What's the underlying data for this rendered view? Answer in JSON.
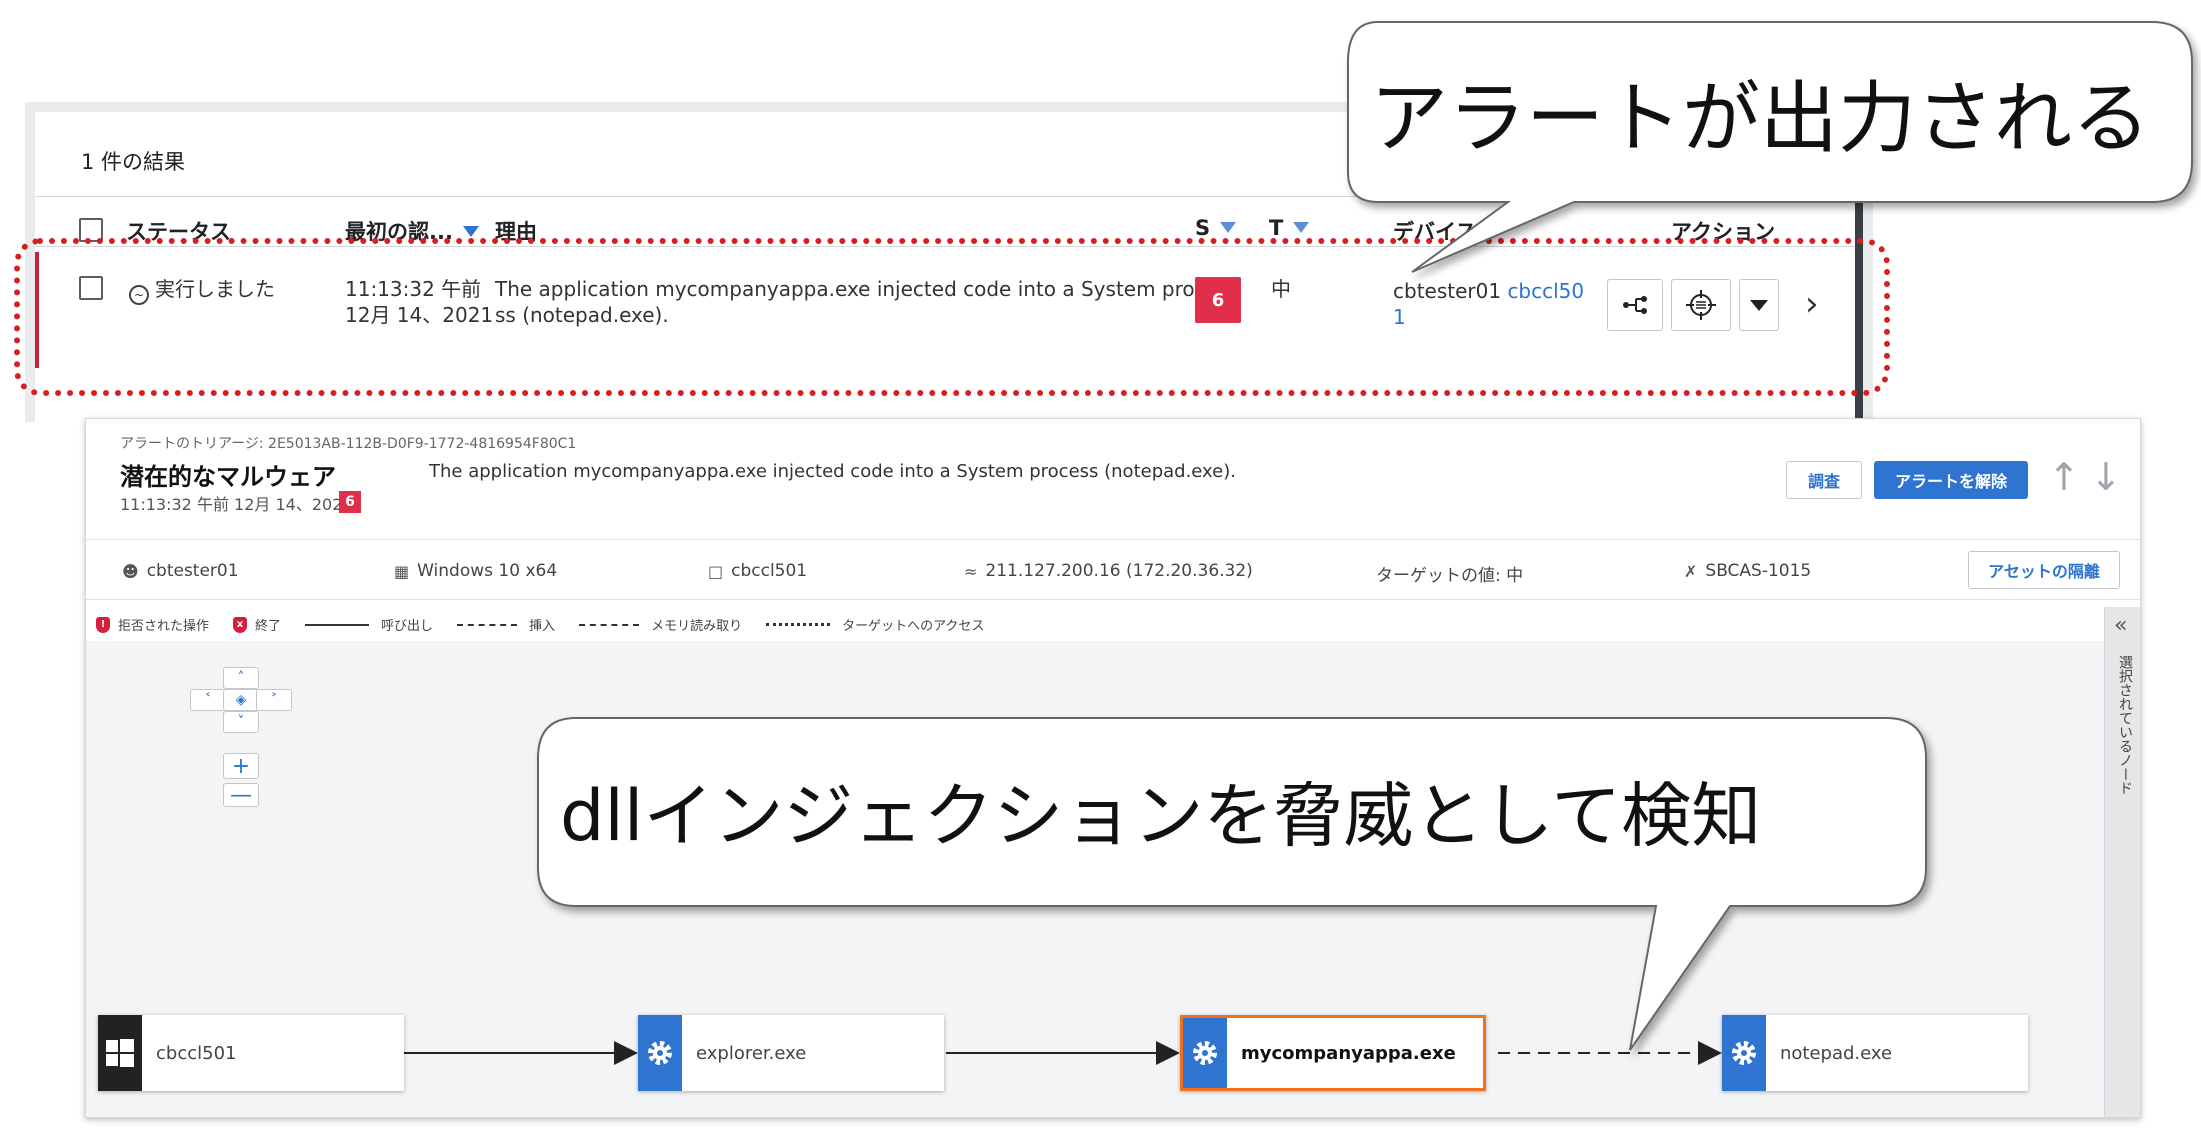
{
  "list": {
    "result_count": "1 件の結果",
    "columns": {
      "status": "ステータス",
      "first_seen": "最初の認...",
      "reason": "理由",
      "s": "S",
      "t": "T",
      "device": "デバイス",
      "actions": "アクション"
    },
    "row": {
      "status": "実行しました",
      "time": "11:13:32 午前",
      "date": "12月 14、2021",
      "reason_line1": "The application mycompanyappa.exe injected code into a System proce",
      "reason_line2": "ss (notepad.exe).",
      "severity": "6",
      "target": "中",
      "device_user": "cbtester01",
      "device_link_line1": "cbccl50",
      "device_link_line2": "1"
    }
  },
  "detail": {
    "triage_id": "アラートのトリアージ: 2E5013AB-112B-D0F9-1772-4816954F80C1",
    "title": "潜在的なマルウェア",
    "time": "11:13:32 午前 12月 14、2021",
    "severity": "6",
    "reason": "The application mycompanyappa.exe injected code into a System process (notepad.exe).",
    "investigate_label": "調査",
    "dismiss_label": "アラートを解除",
    "meta": {
      "user": "cbtester01",
      "os": "Windows 10 x64",
      "device": "cbccl501",
      "ip": "211.127.200.16 (172.20.36.32)",
      "target_value": "ターゲットの値: 中",
      "policy": "SBCAS-1015"
    },
    "isolate_label": "アセットの隔離",
    "legend": {
      "denied": "拒否された操作",
      "terminated": "終了",
      "call": "呼び出し",
      "insert": "挿入",
      "memory_read": "メモリ読み取り",
      "target_access": "ターゲットへのアクセス"
    },
    "side_panel_label": "選択されているノード",
    "nodes": {
      "device": "cbccl501",
      "explorer": "explorer.exe",
      "mycompany": "mycompanyappa.exe",
      "notepad": "notepad.exe"
    }
  },
  "callouts": {
    "top": "アラートが出力される",
    "bottom": "dllインジェクションを脅威として検知"
  },
  "colors": {
    "accent_blue": "#2f74d0",
    "severity_red": "#e02f4b",
    "highlight_orange": "#f07020",
    "annotation_red": "#d61f1f"
  }
}
